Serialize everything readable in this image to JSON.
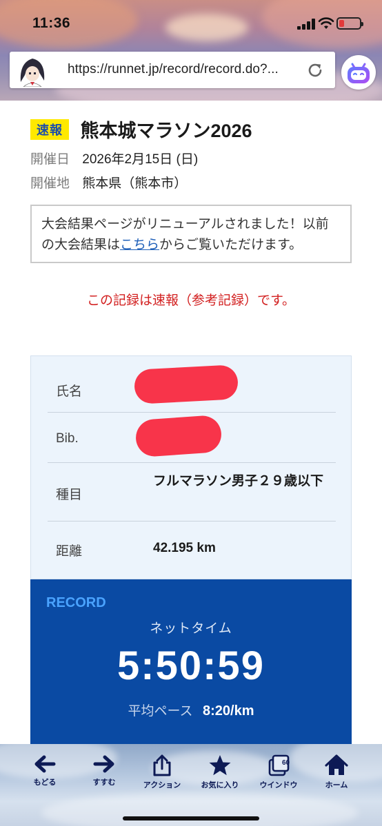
{
  "status_bar": {
    "time": "11:36"
  },
  "browser": {
    "url": "https://runnet.jp/record/record.do?...",
    "reload_icon": "reload-icon",
    "extension_icon": "robot-face-icon"
  },
  "event": {
    "badge": "速報",
    "title": "熊本城マラソン2026",
    "date_label": "開催日",
    "date_value": "2026年2月15日 (日)",
    "venue_label": "開催地",
    "venue_value": "熊本県（熊本市）"
  },
  "notice": {
    "text_before": "大会結果ページがリニューアルされました！以前の大会結果は",
    "link": "こちら",
    "text_after": "からご覧いただけます。"
  },
  "warning": "この記録は速報（参考記録）です。",
  "result": {
    "rows": [
      {
        "label": "氏名",
        "value": ""
      },
      {
        "label": "Bib.",
        "value": ""
      },
      {
        "label": "種目",
        "value": "フルマラソン男子２９歳以下"
      },
      {
        "label": "距離",
        "value": "42.195 km"
      }
    ]
  },
  "record": {
    "heading": "RECORD",
    "net_label": "ネットタイム",
    "net_time": "5:50:59",
    "pace_label": "平均ペース",
    "pace_value": "8:20/km"
  },
  "toolbar": {
    "items": [
      {
        "label": "もどる",
        "icon": "arrow-left-icon"
      },
      {
        "label": "すすむ",
        "icon": "arrow-right-icon"
      },
      {
        "label": "アクション",
        "icon": "share-icon"
      },
      {
        "label": "お気に入り",
        "icon": "star-icon"
      },
      {
        "label": "ウインドウ",
        "icon": "windows-icon",
        "badge": "60"
      },
      {
        "label": "ホーム",
        "icon": "home-icon"
      }
    ]
  },
  "colors": {
    "badge_bg": "#ffe900",
    "badge_text": "#1f4fa8",
    "warning": "#d21f1f",
    "record_bg": "#0a4aa3",
    "record_heading": "#4aa3ff",
    "redaction": "#f8344a"
  }
}
